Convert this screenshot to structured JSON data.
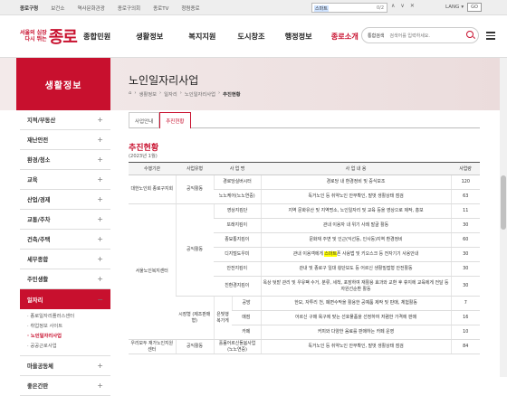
{
  "util": {
    "links": [
      "종로구청",
      "보건소",
      "역사문화관광",
      "종로구의회",
      "종로TV",
      "청렴종로"
    ],
    "find_query": "스마트",
    "find_count": "0/2",
    "find_prev": "∧",
    "find_next": "∨",
    "find_close": "✕",
    "lang": "LANG",
    "go": "GO"
  },
  "logo": {
    "line1": "서울의 심장",
    "line2": "다시 뛰는",
    "name": "종로"
  },
  "menu": [
    "종합민원",
    "생활정보",
    "복지지원",
    "도시창조",
    "행정정보",
    "종로소개"
  ],
  "search": {
    "scope": "통합검색",
    "placeholder": "검색어를 입력하세요."
  },
  "side": {
    "head": "생활정보",
    "items": [
      "지적/부동산",
      "재난안전",
      "환경/청소",
      "교육",
      "산업/경제",
      "교통/주차",
      "건축/주택",
      "세무종합",
      "주민생활",
      "일자리"
    ],
    "active": "일자리",
    "sub": [
      "종로일자리플러스센터",
      "취업정보 사이트",
      "노인일자리사업",
      "공공근로사업"
    ],
    "sub_on": "노인일자리사업",
    "after": [
      "마을공동체",
      "좋은간판"
    ]
  },
  "page": {
    "title": "노인일자리사업",
    "crumb": [
      "생활정보",
      "일자리",
      "노인일자리사업",
      "추진현황"
    ],
    "tabs": [
      "사업안내",
      "추진현황"
    ],
    "section": "추진현황",
    "section_sub": "(2023년 1월)"
  },
  "table": {
    "headers": [
      "수행기관",
      "사업유형",
      "사 업 명",
      "사 업 내 용",
      "사업량"
    ],
    "rows": [
      {
        "org": "대한노인회 종로구지회",
        "type": "공익활동",
        "name": "경로당실버시터",
        "content": "경로당 내 환경정비 및 중식보조",
        "qty": "120"
      },
      {
        "org": "",
        "type": "",
        "name": "노노케어(노노연중)",
        "content": "독거노인 등 취약노인 안부확인, 말벗 생활상태 점검",
        "qty": "63"
      },
      {
        "org": "서울노인복지센터",
        "type": "공익활동",
        "name": "영상지킴단",
        "content": "지역 문화유산 및 지역명소, 노인일자리 및 교육 등을 영상으로 제작, 홍보",
        "qty": "11"
      },
      {
        "org": "",
        "type": "",
        "name": "또래지킴이",
        "content": "관내 이용자 내 위기 사례 발굴 활동",
        "qty": "30"
      },
      {
        "org": "",
        "type": "",
        "name": "종묘통지킴이",
        "content": "문화재 주변 및 인근(익선동, 인사동)지역 환경정비",
        "qty": "60"
      },
      {
        "org": "",
        "type": "",
        "name": "디지털도우미",
        "content_pre": "관내 이용객에게 ",
        "content_hl": "스마트",
        "content_post": "폰 사용법 및 키오스크 등 전자기기 사용안내",
        "qty": "30"
      },
      {
        "org": "",
        "type": "",
        "name": "안전지킴이",
        "content": "관내 및 종로구 일대 횡단보도 등 어르신 생활밀접형 안전활동",
        "qty": "30"
      },
      {
        "org": "",
        "type": "",
        "name": "친환경지킴이",
        "content": "옥상 텃밭 관리 및 우유팩 수거, 분류, 세척, 포장하여 재활용 효과와 교환 후 휴지에 교육에게 전달 등 자원선순환 활동",
        "qty": "30"
      },
      {
        "org": "",
        "type": "시장형 (제조판매형)",
        "sub1": "은빛행복가게",
        "sub2": "공방",
        "content": "한모, 자투리 천, 폐면수막을 활용한 공예품 제작 및 판매, 체험활동",
        "qty": "7"
      },
      {
        "org": "",
        "type": "",
        "sub1": "",
        "sub2": "매점",
        "content": "어르신 구매 욕구에 맞는 선호물품을 선정하여 저렴한 가격에 판매",
        "qty": "16"
      },
      {
        "org": "",
        "type": "",
        "sub1": "",
        "sub2": "카페",
        "content": "커피와 다양한 음료를 판매하는 카페 운영",
        "qty": "10"
      },
      {
        "org": "우리모두 재가노인지원센터",
        "type": "공익활동",
        "name": "홀몸어르신돌봄사업 (노노연중)",
        "content": "독거노인 등 취약노인 안부확인, 말벗 생활상태 점검",
        "qty": "84"
      }
    ]
  }
}
